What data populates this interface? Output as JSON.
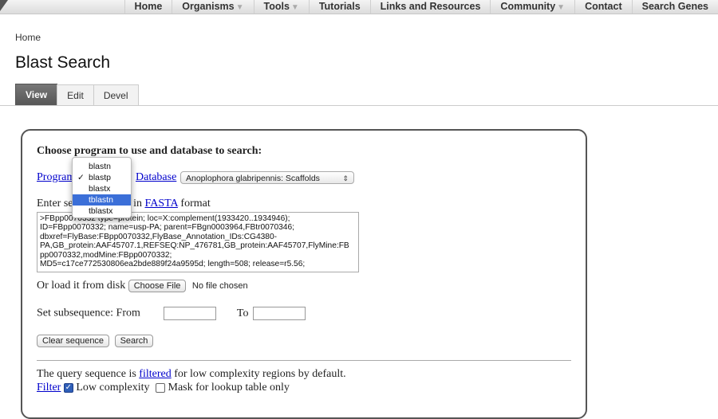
{
  "nav": {
    "items": [
      {
        "label": "Home",
        "dropdown": false
      },
      {
        "label": "Organisms",
        "dropdown": true
      },
      {
        "label": "Tools",
        "dropdown": true
      },
      {
        "label": "Tutorials",
        "dropdown": false
      },
      {
        "label": "Links and Resources",
        "dropdown": false
      },
      {
        "label": "Community",
        "dropdown": true
      },
      {
        "label": "Contact",
        "dropdown": false
      },
      {
        "label": "Search Genes",
        "dropdown": false
      }
    ],
    "dropdown_glyph": "▼"
  },
  "breadcrumb": "Home",
  "page_title": "Blast Search",
  "tabs": [
    {
      "label": "View",
      "active": true
    },
    {
      "label": "Edit",
      "active": false
    },
    {
      "label": "Devel",
      "active": false
    }
  ],
  "form": {
    "heading": "Choose program to use and database to search:",
    "program_link": "Program",
    "database_link": "Database",
    "database_value": "Anoplophora glabripennis: Scaffolds",
    "enter_prefix": "Enter se",
    "enter_middle": "w in ",
    "fasta_link": "FASTA",
    "enter_suffix": " format",
    "sequence_lines": [
      ">FBpp0070332 type=protein; loc=X:complement(1933420..1934946);",
      "ID=FBpp0070332; name=usp-PA; parent=FBgn0003964,FBtr0070346;",
      "dbxref=FlyBase:FBpp0070332,FlyBase_Annotation_IDs:CG4380-",
      "PA,GB_protein:AAF45707.1,REFSEQ:NP_476781,GB_protein:AAF45707,FlyMine:FB",
      "pp0070332,modMine:FBpp0070332;",
      "MD5=c17ce772530806ea2bde889f24a9595d; length=508; release=r5.56;"
    ],
    "load_label": "Or load it from disk",
    "choose_file": "Choose File",
    "no_file": "No file chosen",
    "subseq_label": "Set subsequence: From",
    "to_label": "To",
    "from_value": "",
    "to_value": "",
    "clear_button": "Clear sequence",
    "search_button": "Search",
    "info_prefix": "The query sequence is ",
    "filtered_link": "filtered",
    "info_suffix": " for low complexity regions by default.",
    "filter_link": "Filter",
    "low_complexity_label": "Low complexity",
    "low_complexity_checked": true,
    "mask_label": "Mask for lookup table only",
    "mask_checked": false
  },
  "program_dropdown": {
    "options": [
      "blastn",
      "blastp",
      "blastx",
      "tblastn",
      "tblastx"
    ],
    "selected": "blastp",
    "highlighted": "tblastn",
    "check_glyph": "✓"
  },
  "colors": {
    "link": "#0000cc",
    "highlight": "#3b6fd8",
    "active_tab": "#555555"
  }
}
